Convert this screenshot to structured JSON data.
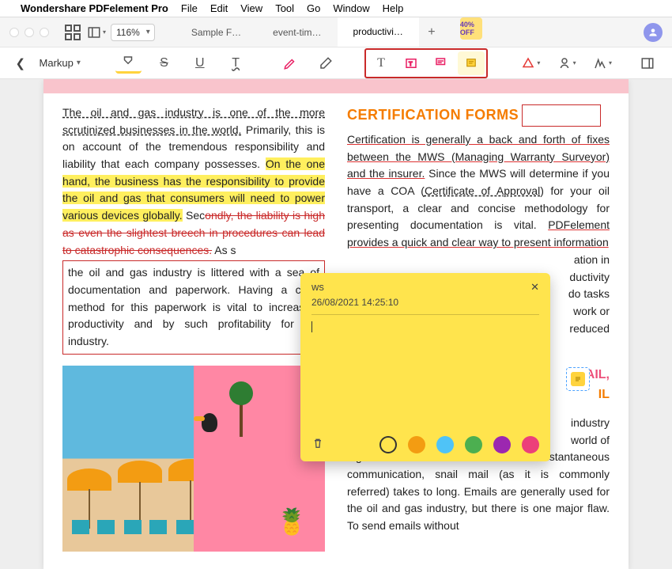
{
  "menubar": {
    "app": "Wondershare PDFelement Pro",
    "items": [
      "File",
      "Edit",
      "View",
      "Tool",
      "Go",
      "Window",
      "Help"
    ]
  },
  "window": {
    "zoom": "116%",
    "tabs": [
      {
        "label": "Sample F…"
      },
      {
        "label": "event-tim…"
      },
      {
        "label": "productivi…"
      }
    ],
    "promo": "40% OFF"
  },
  "toolbar": {
    "mode": "Markup"
  },
  "document": {
    "left": {
      "p1a": "The oil and gas industry is one of the more scrutinized businesses in the world.",
      "p1b": "Primarily, this is on account of the tremendous responsibility and liability that each company possesses. ",
      "p1c": "On the one hand, the business has the responsibility to provide the oil and gas that consumers will need to power various devices globally.",
      "p1d": " Sec",
      "p1e": "ondly, the liability is high as even the slightest breech in procedures can lead to catastrophic consequences.",
      "p1f": " As s",
      "p1g": "the oil and gas industry is littered with a sea of documentation and paperwork. Having a clear method for this paperwork is vital to increasing productivity and by such profitability for the industry."
    },
    "right": {
      "heading": "CERTIFICATION FORMS",
      "p2a": "Certification is generally a back and forth of fixes between the MWS (Managing Warranty Surveyor) and the insurer.",
      "p2b": " Since the MWS will determine if you have a COA (",
      "p2c": "Certificate of Approval",
      "p2d": ") for your oil transport, a clear and concise methodology for presenting documentation is vital. ",
      "p2e": "PDFelement provides a quick and clear way to present information",
      "p2f": "ation in",
      "p2g": "ductivity",
      "p2h": "do tasks",
      "p2i": "work or",
      "p2j": "reduced",
      "h2a": "MAIL,",
      "h2b": "IL",
      "p3a": "industry",
      "p3b": "world of",
      "p3c": "digital media and mass/instantaneous communication, snail mail (as it is commonly referred) takes to long. Emails are generally used for the oil and gas industry, but there is one major flaw. To send emails without"
    }
  },
  "note": {
    "author": "ws",
    "timestamp": "26/08/2021 14:25:10"
  }
}
